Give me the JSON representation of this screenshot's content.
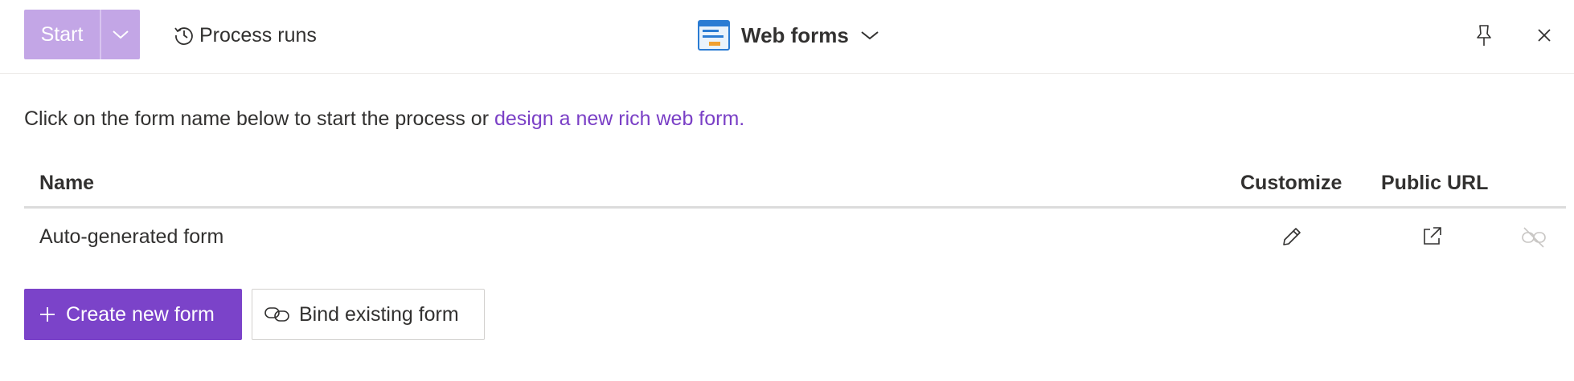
{
  "header": {
    "start_label": "Start",
    "process_runs_label": "Process runs",
    "title": "Web forms"
  },
  "intro": {
    "text": "Click on the form name below to start the process or ",
    "link_text": "design a new rich web form."
  },
  "table": {
    "columns": [
      "Name",
      "Customize",
      "Public URL"
    ],
    "rows": [
      {
        "name": "Auto-generated form"
      }
    ]
  },
  "actions": {
    "create_label": "Create new form",
    "bind_label": "Bind existing form"
  },
  "colors": {
    "accent": "#7b43c9",
    "accent_disabled": "#c3a6e6",
    "link": "#7a3fc6"
  }
}
